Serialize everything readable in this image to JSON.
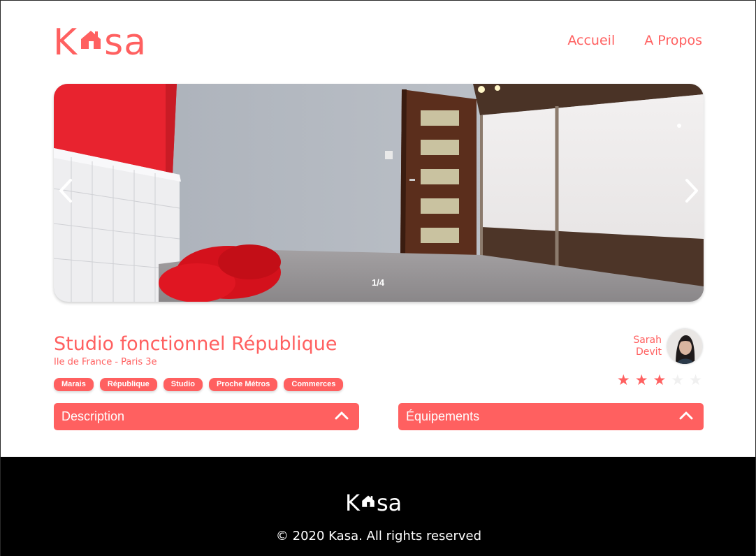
{
  "header": {
    "logo_left": "K",
    "logo_right": "sa",
    "nav": [
      "Accueil",
      "A Propos"
    ]
  },
  "carousel": {
    "counter": "1/4",
    "prev_icon": "chevron-left-icon",
    "next_icon": "chevron-right-icon"
  },
  "listing": {
    "title": "Studio fonctionnel République",
    "location": "Ile de France - Paris 3e",
    "tags": [
      "Marais",
      "République",
      "Studio",
      "Proche Métros",
      "Commerces"
    ],
    "host": {
      "first_name": "Sarah",
      "last_name": "Devit"
    },
    "rating": 3,
    "rating_max": 5
  },
  "collapses": {
    "description": "Description",
    "equipment": "Équipements"
  },
  "footer": {
    "logo_left": "K",
    "logo_right": "sa",
    "copyright": "© 2020 Kasa. All rights reserved"
  },
  "colors": {
    "accent": "#FF6060",
    "footer_bg": "#000000"
  }
}
